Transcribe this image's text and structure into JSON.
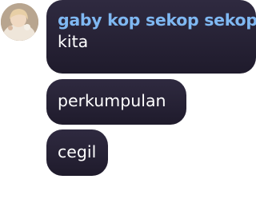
{
  "colors": {
    "bubble_bg": "#2a2638",
    "sender_name": "#7fb8f2",
    "message_text": "#ffffff"
  },
  "avatar": {
    "icon": "user-avatar-photo"
  },
  "messages": [
    {
      "sender": "gaby kop sekop sekop",
      "text": "kita"
    },
    {
      "text": "perkumpulan"
    },
    {
      "text": "cegil"
    }
  ]
}
